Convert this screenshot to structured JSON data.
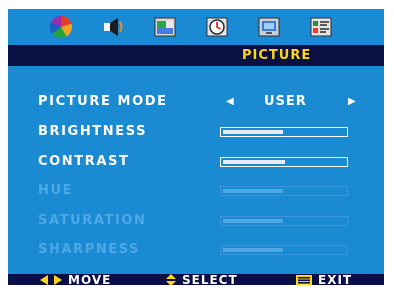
{
  "menu": {
    "title": "PICTURE",
    "tabs": [
      {
        "icon": "color-wheel-icon",
        "active": true
      },
      {
        "icon": "speaker-icon",
        "active": false
      },
      {
        "icon": "screen-window-icon",
        "active": false
      },
      {
        "icon": "clock-icon",
        "active": false
      },
      {
        "icon": "pc-monitor-icon",
        "active": false
      },
      {
        "icon": "setup-icon",
        "active": false
      }
    ]
  },
  "settings": {
    "picture_mode": {
      "label": "PICTURE MODE",
      "value": "USER"
    },
    "brightness": {
      "label": "BRIGHTNESS",
      "level": 0.5
    },
    "contrast": {
      "label": "CONTRAST",
      "level": 0.52
    },
    "hue": {
      "label": "HUE",
      "level": 0.5,
      "enabled": false
    },
    "saturation": {
      "label": "SATURATION",
      "level": 0.5,
      "enabled": false
    },
    "sharpness": {
      "label": "SHARPNESS",
      "level": 0.5,
      "enabled": false
    }
  },
  "footer": {
    "move": "MOVE",
    "select": "SELECT",
    "exit": "EXIT"
  },
  "colors": {
    "background": "#1a8ad2",
    "bar": "#0a0f44",
    "title_text": "#ffd61a",
    "move_arrows": "#ffd61a",
    "select_icon": "#ffd61a"
  }
}
